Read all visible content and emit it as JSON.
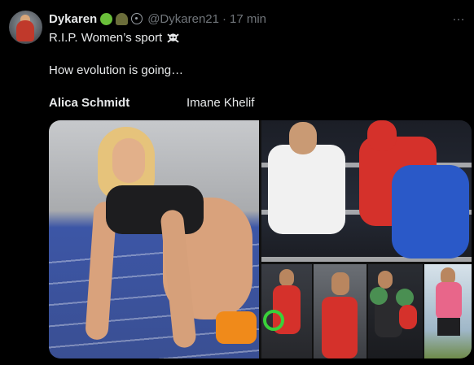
{
  "tweet": {
    "display_name": "Dykaren",
    "handle": "@Dykaren21",
    "separator": "·",
    "time": "17 min",
    "more_icon": "…",
    "line1": "R.I.P. Women’s sport",
    "line2": "How evolution is going…",
    "label_left": "Alica Schmidt",
    "label_right": "Imane Khelif"
  },
  "badges": [
    "frog-emoji",
    "helmet-emoji",
    "wheel-icon"
  ],
  "colors": {
    "background": "#000000",
    "text": "#e7e9ea",
    "muted": "#71767b",
    "highlight_ring": "#3ad13a"
  }
}
